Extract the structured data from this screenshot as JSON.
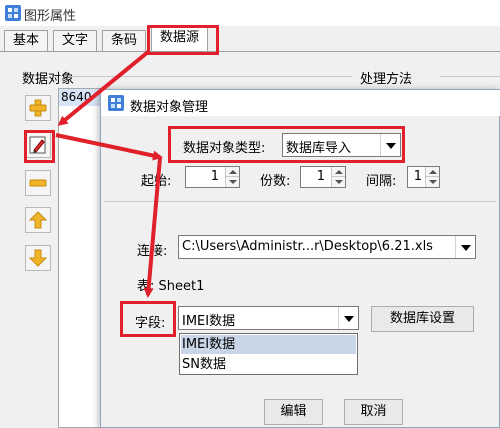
{
  "window": {
    "title": "图形属性"
  },
  "tabs": [
    "基本",
    "文字",
    "条码",
    "数据源"
  ],
  "groups": {
    "data_objects": "数据对象",
    "process_method": "处理方法"
  },
  "list": {
    "item_partial": "8640"
  },
  "dialog": {
    "title": "数据对象管理",
    "type_label": "数据对象类型:",
    "type_value": "数据库导入",
    "start_label": "起始:",
    "start_value": "1",
    "copies_label": "份数:",
    "copies_value": "1",
    "interval_label": "间隔:",
    "interval_value": "1",
    "connect_label": "连接:",
    "connect_value": "C:\\Users\\Administr...r\\Desktop\\6.21.xls",
    "table_label": "表: Sheet1",
    "field_label": "字段:",
    "field_value": "IMEI数据",
    "db_settings_button": "数据库设置",
    "field_options": [
      "IMEI数据",
      "SN数据"
    ],
    "edit_button": "编辑",
    "cancel_button": "取消"
  },
  "colors": {
    "highlight_box": "#e0202a",
    "arrow": "#e0202a",
    "selection": "#c9d6e8"
  },
  "icons": [
    "app-icon",
    "add-icon",
    "edit-icon",
    "remove-icon",
    "move-up-icon",
    "move-down-icon",
    "dialog-icon"
  ]
}
